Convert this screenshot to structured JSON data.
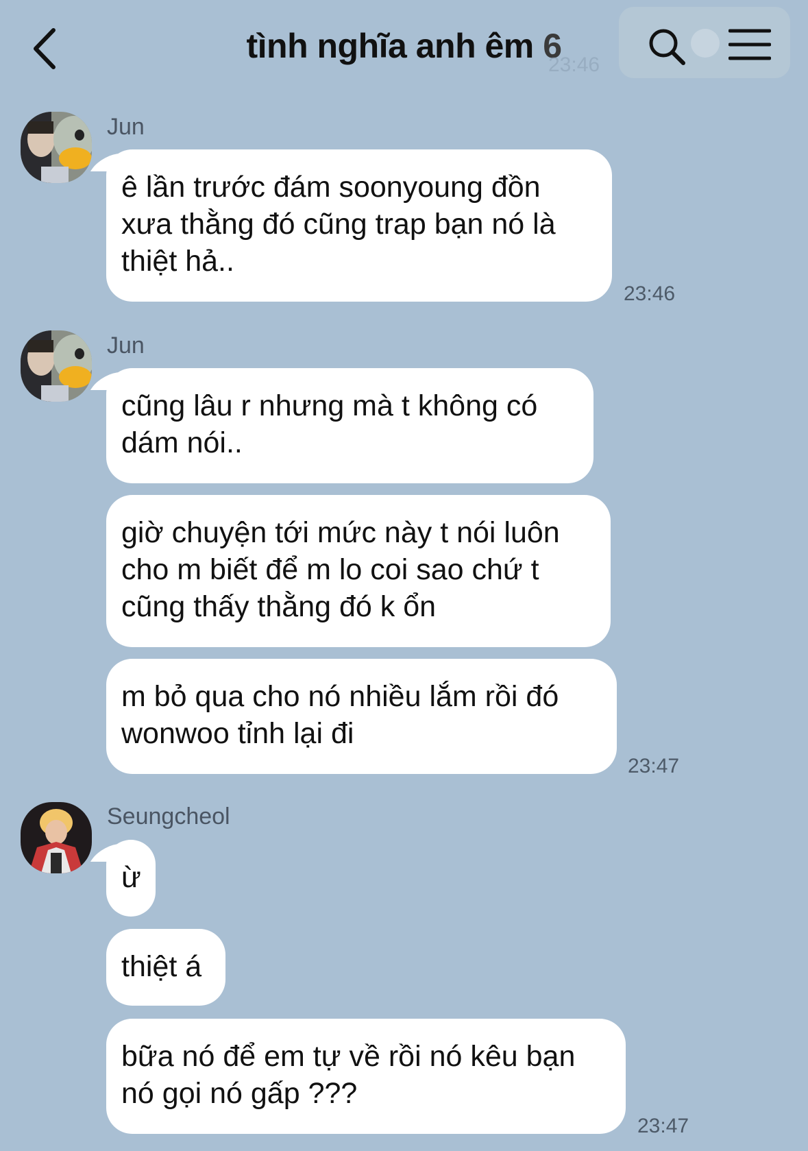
{
  "header": {
    "title": "tình nghĩa anh êm",
    "member_count": "6",
    "ghost_time": "23:46",
    "back_icon": "chevron-left-icon",
    "search_icon": "search-icon",
    "menu_icon": "hamburger-menu-icon"
  },
  "messages": [
    {
      "sender": "Jun",
      "text": "ê lần trước đám soonyoung đồn\nxưa thằng đó cũng trap bạn nó là\nthiệt hả..",
      "time": "23:46"
    },
    {
      "sender": "Jun",
      "text": "cũng lâu r nhưng mà t không có\ndám nói.."
    },
    {
      "text": "giờ chuyện tới mức này t nói luôn\ncho m biết để m lo coi sao chứ t\ncũng thấy thằng đó k ổn"
    },
    {
      "text": "m bỏ qua cho nó nhiều lắm rồi đó\nwonwoo tỉnh lại đi",
      "time": "23:47"
    },
    {
      "sender": "Seungcheol",
      "text": "ừ"
    },
    {
      "text": "thiệt á"
    },
    {
      "text": "bữa nó để em tự về rồi nó kêu bạn\nnó gọi nó gấp ???",
      "time": "23:47"
    }
  ],
  "colors": {
    "background": "#a9bfd3",
    "bubble": "#ffffff",
    "timestamp": "#4d5a68"
  }
}
